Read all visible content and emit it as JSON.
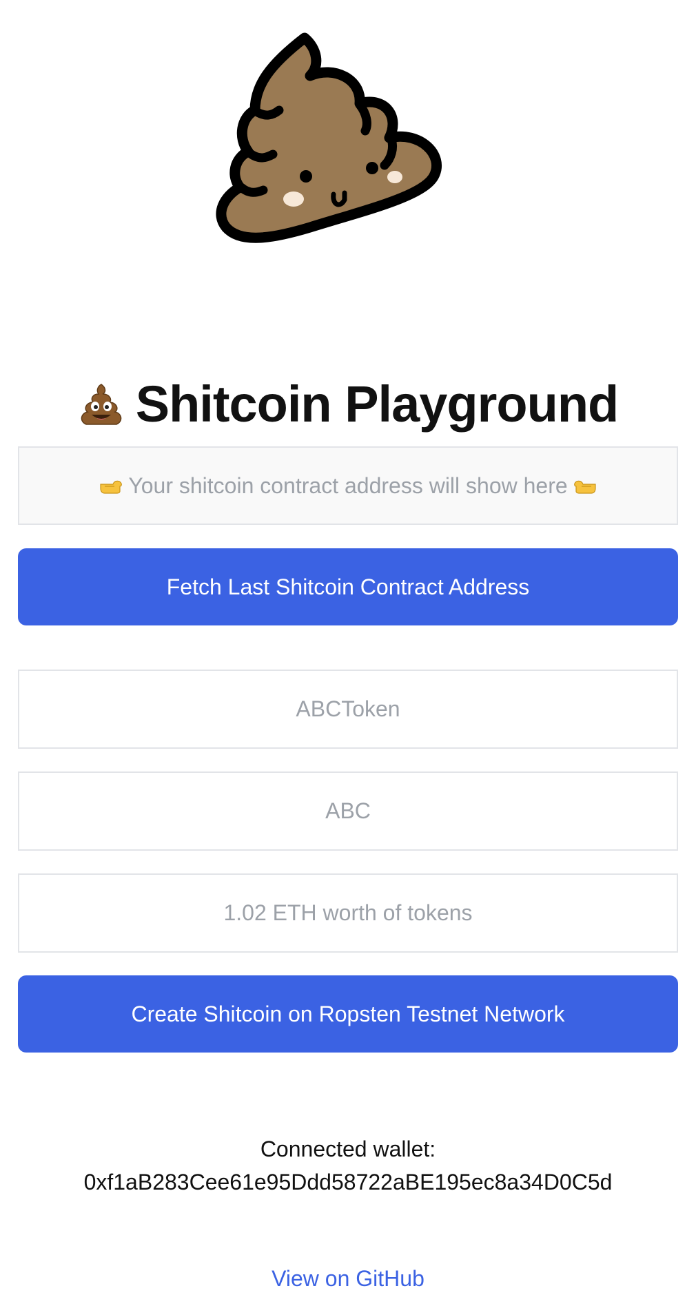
{
  "header": {
    "mascot_icon": "poop-mascot-icon",
    "title": "Shitcoin Playground",
    "title_icon": "poop-emoji-icon"
  },
  "contract": {
    "placeholder_text": "Your shitcoin contract address will show here",
    "left_icon": "pointing-right-hand-icon",
    "right_icon": "pointing-left-hand-icon",
    "fetch_button_label": "Fetch Last Shitcoin Contract Address"
  },
  "form": {
    "name_placeholder": "ABCToken",
    "symbol_placeholder": "ABC",
    "amount_placeholder": "1.02 ETH worth of tokens",
    "create_button_label": "Create Shitcoin on Ropsten Testnet Network"
  },
  "wallet": {
    "label": "Connected wallet:",
    "address": "0xf1aB283Cee61e95Ddd58722aBE195ec8a34D0C5d"
  },
  "footer": {
    "github_link": "View on GitHub"
  },
  "colors": {
    "primary_button": "#3b62e3",
    "link": "#3b62e3",
    "placeholder_text": "#9ca1a8",
    "border": "#e2e4e8",
    "mascot_fill": "#9a7a53"
  }
}
